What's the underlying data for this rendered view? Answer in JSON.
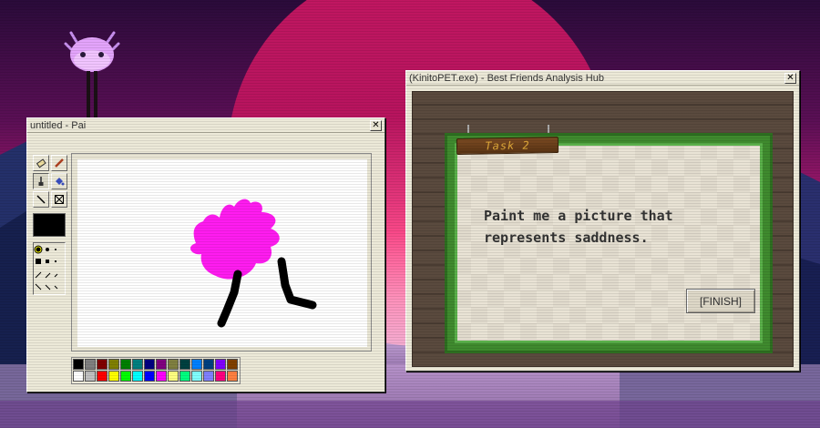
{
  "paint_window": {
    "title": "untitled - Pai",
    "close_label": "✕",
    "current_color": "#000000",
    "palette": {
      "row1": [
        "#000000",
        "#808080",
        "#800000",
        "#808000",
        "#008000",
        "#008080",
        "#000080",
        "#800080",
        "#808040",
        "#004040",
        "#0080ff",
        "#004080",
        "#8000ff",
        "#804000"
      ],
      "row2": [
        "#ffffff",
        "#c0c0c0",
        "#ff0000",
        "#ffff00",
        "#00ff00",
        "#00ffff",
        "#0000ff",
        "#ff00ff",
        "#ffff80",
        "#00ff80",
        "#80ffff",
        "#8080ff",
        "#ff0080",
        "#ff8040"
      ]
    },
    "drawing": {
      "blob_color": "#ff1cf0",
      "leg_color": "#000000"
    }
  },
  "hub_window": {
    "title": "(KinitoPET.exe) - Best Friends Analysis Hub",
    "close_label": "✕",
    "task_label": "Task 2",
    "prompt": "Paint me a picture that\nrepresents saddness.",
    "finish_label": "[FINISH]"
  },
  "colors": {
    "frame_green": "#3f8a2e",
    "wood": "#5a4a3e",
    "creature_body": "#e8a8ff"
  }
}
